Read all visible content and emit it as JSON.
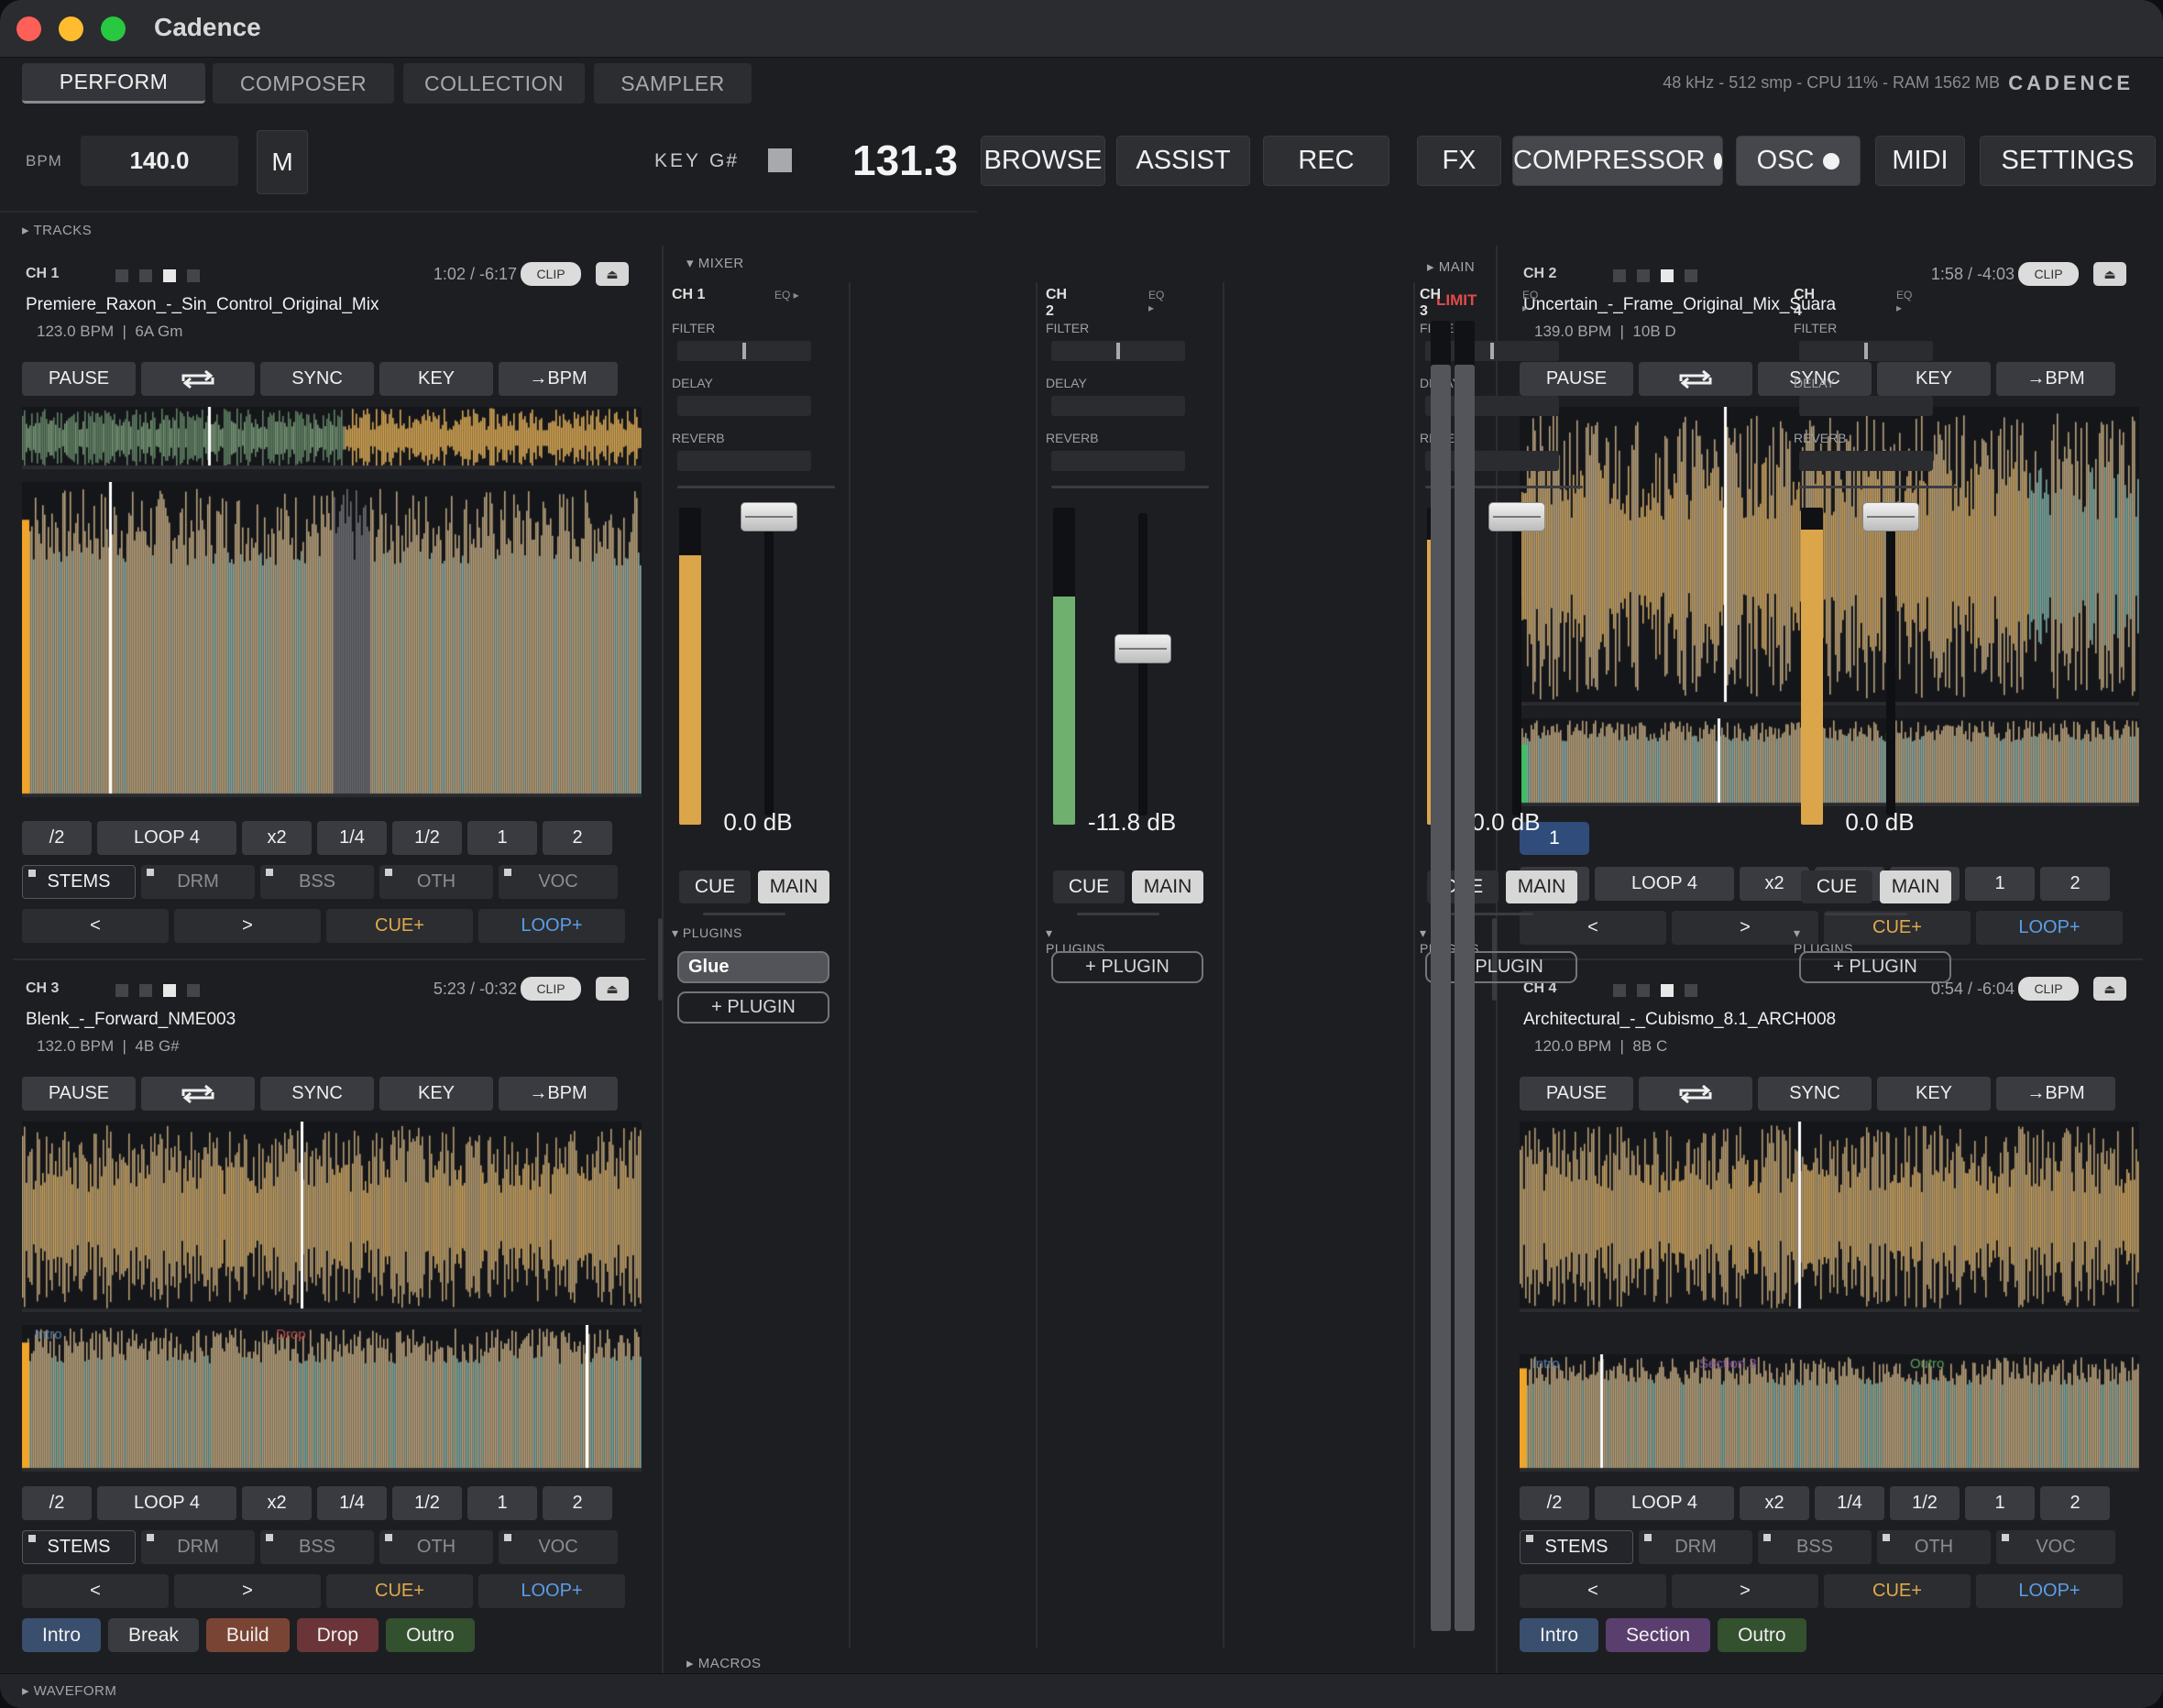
{
  "app": {
    "title": "Cadence",
    "brand": "CADENCE",
    "sysinfo": "48 kHz  -  512 smp  -  CPU 11%  -  RAM 1562 MB"
  },
  "tabs": [
    "PERFORM",
    "COMPOSER",
    "COLLECTION",
    "SAMPLER"
  ],
  "transport": {
    "bpm_label": "BPM",
    "bpm_value": "140.0",
    "master_btn": "M",
    "key_label": "KEY",
    "key_value": "G#",
    "tempo_display": "131.3",
    "buttons": [
      "BROWSE",
      "ASSIST",
      "REC",
      "FX",
      "COMPRESSOR",
      "OSC",
      "MIDI",
      "SETTINGS"
    ]
  },
  "sections": {
    "tracks": "TRACKS",
    "mixer": "MIXER",
    "main": "MAIN",
    "limit": "LIMIT",
    "macros": "MACROS",
    "waveform": "WAVEFORM",
    "plugins": "PLUGINS",
    "filter": "FILTER",
    "delay": "DELAY",
    "reverb": "REVERB",
    "eq": "EQ ▸"
  },
  "deck_labels": {
    "clip": "CLIP",
    "pause": "PAUSE",
    "sync": "SYNC",
    "key": "KEY",
    "tobpm": "→BPM",
    "loop_row": [
      "/2",
      "LOOP 4",
      "x2",
      "1/4",
      "1/2",
      "1",
      "2"
    ],
    "stems": [
      "STEMS",
      "DRM",
      "BSS",
      "OTH",
      "VOC"
    ],
    "nav": [
      "<",
      ">",
      "CUE+",
      "LOOP+"
    ]
  },
  "decks": [
    {
      "ch": "CH 1",
      "time": "1:02 / -6:17",
      "name": "Premiere_Raxon_-_Sin_Control_Original_Mix",
      "bpm": "123.0 BPM",
      "key": "6A Gm",
      "progress": 0.14,
      "hotcues": [],
      "sections": [],
      "stems": true
    },
    {
      "ch": "CH 2",
      "time": "1:58 / -4:03",
      "name": "Uncertain_-_Frame_Original_Mix_Suara",
      "bpm": "139.0 BPM",
      "key": "10B D",
      "progress": 0.33,
      "hotcues": [
        "1"
      ],
      "sections": [],
      "stems": false
    },
    {
      "ch": "CH 3",
      "time": "5:23 / -0:32",
      "name": "Blenk_-_Forward_NME003",
      "bpm": "132.0 BPM",
      "key": "4B G#",
      "progress": 0.91,
      "hotcues": [],
      "sections": [
        "Intro",
        "Break",
        "Build",
        "Drop",
        "Outro"
      ],
      "wave_labels": [
        "Intro",
        "Drop"
      ],
      "stems": true
    },
    {
      "ch": "CH 4",
      "time": "0:54 / -6:04",
      "name": "Architectural_-_Cubismo_8.1_ARCH008",
      "bpm": "120.0 BPM",
      "key": "8B C",
      "progress": 0.13,
      "hotcues": [],
      "sections": [
        "Intro",
        "Section",
        "Outro"
      ],
      "wave_labels": [
        "Intro",
        "Section 3",
        "Outro"
      ],
      "stems": true
    }
  ],
  "section_colors": {
    "Intro": "#3a4e6e",
    "Break": "#3a3b40",
    "Build": "#7a4434",
    "Drop": "#6a3438",
    "Outro": "#33502f",
    "Section": "#5a3e6e"
  },
  "mixer": {
    "channels": [
      {
        "ch": "CH 1",
        "db": "0.0 dB",
        "level": 0.85,
        "meter_color": "#dba54a",
        "fader": 1.0,
        "filter": 0.5,
        "plugins": [
          "Glue"
        ]
      },
      {
        "ch": "CH 2",
        "db": "-11.8 dB",
        "level": 0.72,
        "meter_color": "#6fb06f",
        "fader": 0.52,
        "filter": 0.5,
        "plugins": []
      },
      {
        "ch": "CH 3",
        "db": "0.0 dB",
        "level": 0.9,
        "meter_color": "#dba54a",
        "fader": 1.0,
        "filter": 0.5,
        "plugins": []
      },
      {
        "ch": "CH 4",
        "db": "0.0 dB",
        "level": 0.93,
        "meter_color": "#dba54a",
        "fader": 1.0,
        "filter": 0.5,
        "plugins": []
      }
    ],
    "cue_label": "CUE",
    "main_label": "MAIN",
    "add_plugin": "+ PLUGIN"
  }
}
